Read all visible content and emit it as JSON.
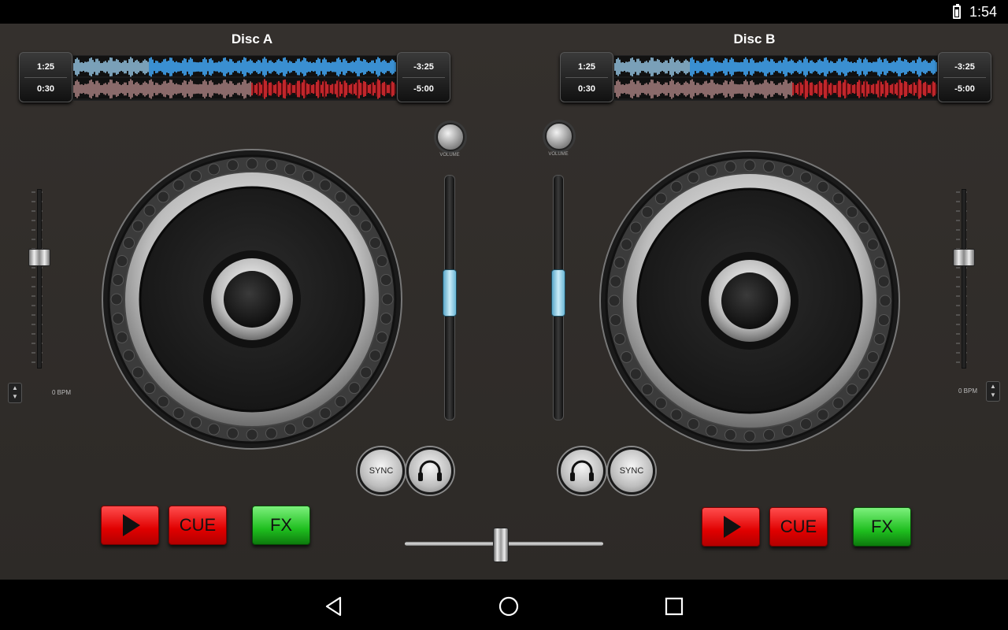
{
  "status_bar": {
    "time": "1:54",
    "icons": [
      "battery-charging-icon"
    ]
  },
  "deck_a": {
    "title": "Disc A",
    "elapsed_top": "1:25",
    "elapsed_bottom": "0:30",
    "remaining_top": "-3:25",
    "remaining_bottom": "-5:00",
    "bpm": "0 BPM",
    "volume_label": "VOLUME",
    "sync_label": "SYNC",
    "cue_label": "CUE",
    "fx_label": "FX",
    "pitch_level": 0.38,
    "volume_fader_level": 0.48,
    "waveform_top_progress": 0.23,
    "waveform_bottom_progress": 0.55
  },
  "deck_b": {
    "title": "Disc B",
    "elapsed_top": "1:25",
    "elapsed_bottom": "0:30",
    "remaining_top": "-3:25",
    "remaining_bottom": "-5:00",
    "bpm": "0 BPM",
    "volume_label": "VOLUME",
    "sync_label": "SYNC",
    "cue_label": "CUE",
    "fx_label": "FX",
    "pitch_level": 0.38,
    "volume_fader_level": 0.48,
    "waveform_top_progress": 0.23,
    "waveform_bottom_progress": 0.55
  },
  "crossfader": {
    "level": 0.48
  },
  "nav_bar": {
    "icons": [
      "back-icon",
      "home-icon",
      "recents-icon"
    ]
  },
  "colors": {
    "wave_blue": "#3a8fd1",
    "wave_red": "#c0262b",
    "play_red": "#e00000",
    "fx_green": "#1fbf1f",
    "fader_blue": "#9ad7ef"
  }
}
